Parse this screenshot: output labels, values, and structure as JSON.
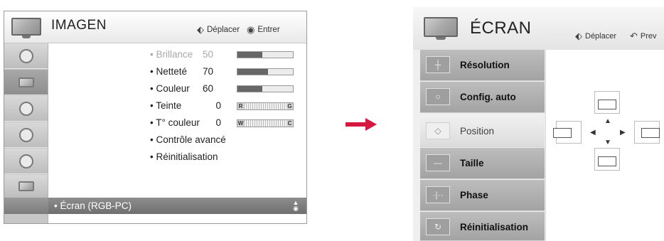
{
  "left_menu": {
    "title": "IMAGEN",
    "hint_move": "Déplacer",
    "hint_enter": "Entrer",
    "sidebar_icons": [
      "picture-icon",
      "tv-screen-icon",
      "speaker-icon",
      "clock-icon",
      "lock-icon",
      "options-icon"
    ],
    "items": [
      {
        "label": "• Brillance",
        "value": "50",
        "level": 0.45,
        "disabled": true
      },
      {
        "label": "• Netteté",
        "value": "70",
        "level": 0.55
      },
      {
        "label": "• Couleur",
        "value": "60",
        "level": 0.45
      },
      {
        "label": "• Teinte",
        "value": "0",
        "left_mark": "R",
        "right_mark": "G"
      },
      {
        "label": "• T° couleur",
        "value": "0",
        "left_mark": "W",
        "right_mark": "C"
      },
      {
        "label": "• Contrôle avancé"
      },
      {
        "label": "• Réinitialisation"
      }
    ],
    "selected_item": "• Écran (RGB-PC)"
  },
  "right_menu": {
    "title": "ÉCRAN",
    "hint_move": "Déplacer",
    "hint_prev": "Prev",
    "items": [
      {
        "label": "Résolution"
      },
      {
        "label": "Config. auto"
      },
      {
        "label": "Position",
        "selected": true
      },
      {
        "label": "Taille"
      },
      {
        "label": "Phase"
      },
      {
        "label": "Réinitialisation"
      }
    ]
  },
  "colors": {
    "selected_row": "#7a7a7a",
    "arrow": "#d6173f",
    "bar_fill": "#666666"
  }
}
